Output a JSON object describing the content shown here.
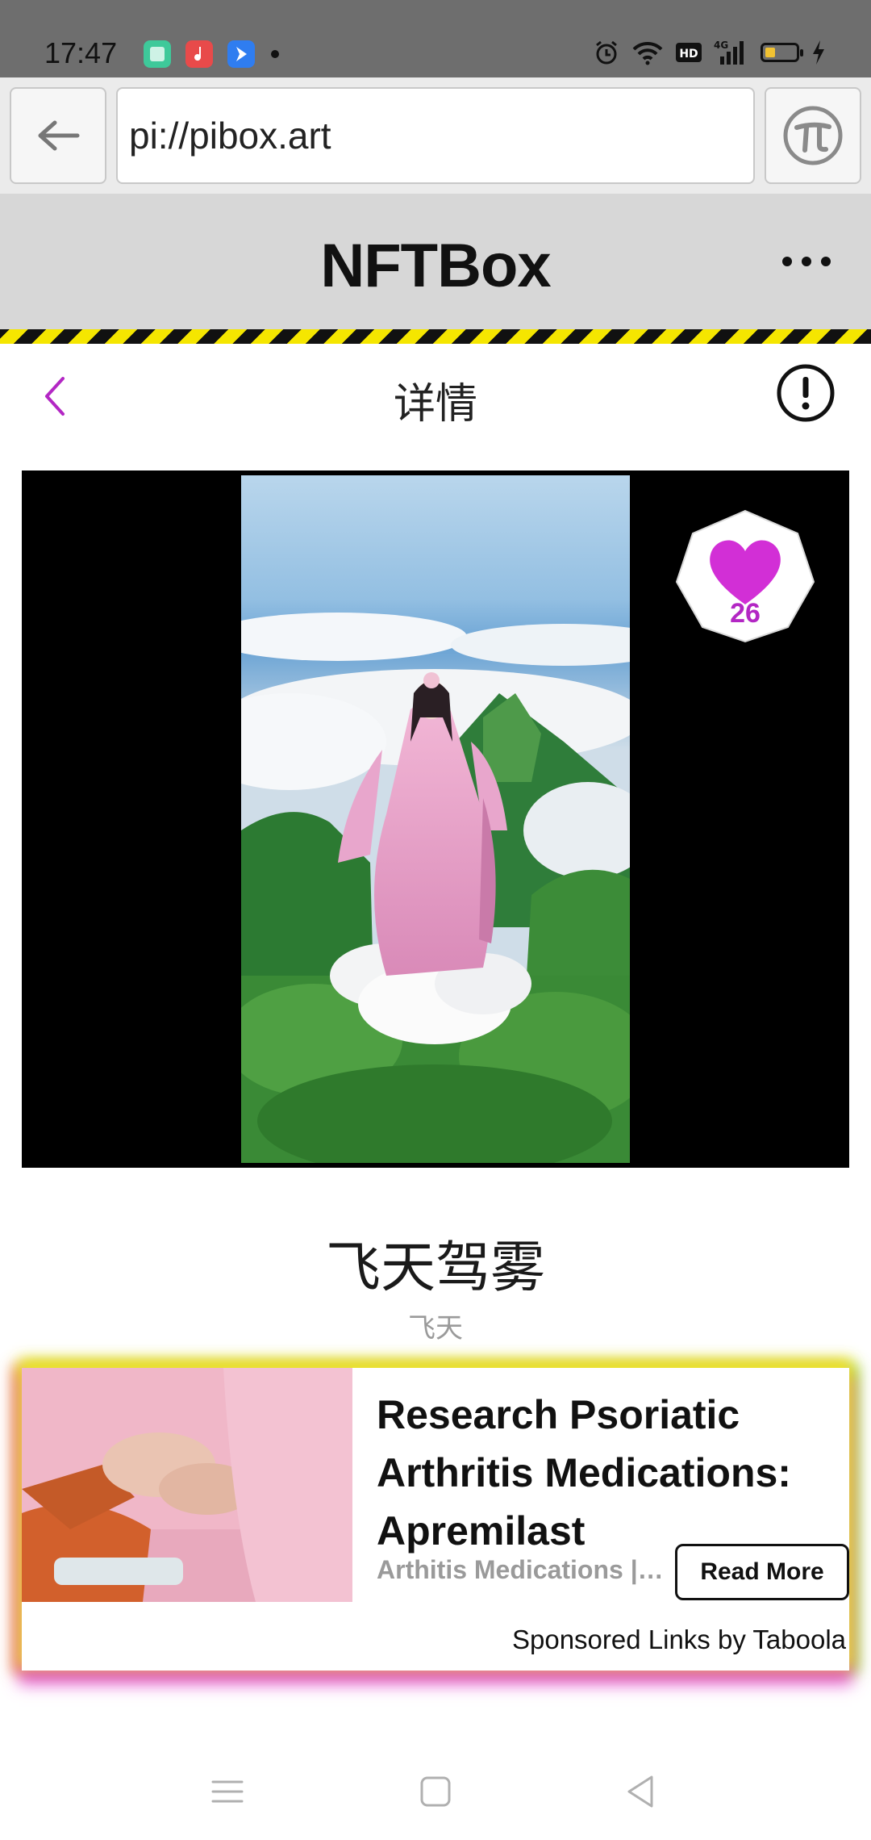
{
  "status_bar": {
    "time": "17:47",
    "icons": [
      "app-notification-green",
      "music-app-icon",
      "app-notification-blue",
      "alarm-icon",
      "wifi-icon",
      "hd-icon",
      "signal-4g-icon",
      "battery-icon",
      "charging-icon"
    ]
  },
  "browser": {
    "url": "pi://pibox.art",
    "back_icon": "arrow-left-icon",
    "pi_icon": "pi-logo-icon"
  },
  "app_header": {
    "title": "NFTBox",
    "more_icon": "more-icon"
  },
  "page": {
    "title": "详情",
    "back_icon": "chevron-left-icon",
    "info_icon": "info-icon"
  },
  "artwork": {
    "likes": "26",
    "like_icon": "heart-icon"
  },
  "nft": {
    "title": "飞天驾雾",
    "subtitle": "飞天"
  },
  "ad": {
    "headline": "Research Psoriatic Arthritis Medications: Apremilast",
    "source": "Arthitis Medications | Search Ads",
    "button_label": "Read More",
    "sponsor": "Sponsored Links by Taboola"
  },
  "nav": {
    "icons": [
      "menu-icon",
      "home-icon",
      "back-triangle-icon"
    ]
  },
  "colors": {
    "accent": "#b327c4",
    "header_bg": "#d7d7d7",
    "hazard_yellow": "#f5e600"
  }
}
